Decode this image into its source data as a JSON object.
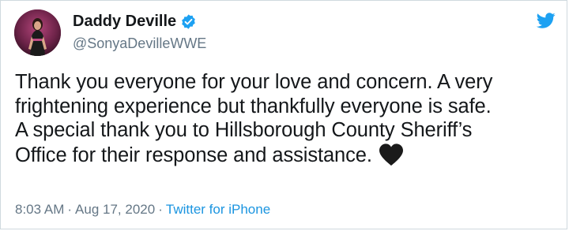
{
  "user": {
    "display_name": "Daddy Deville",
    "handle": "@SonyaDevilleWWE",
    "verified": true
  },
  "tweet": {
    "line1": "Thank you everyone for your love and concern. A very",
    "line2": "frightening experience but thankfully everyone is safe.",
    "line3": "A special thank you to Hillsborough County Sheriff’s",
    "line4": "Office for their response and assistance.",
    "emoji": "black-heart-icon"
  },
  "meta": {
    "time": "8:03 AM",
    "separator": "·",
    "date": "Aug 17, 2020",
    "source": "Twitter for iPhone"
  },
  "colors": {
    "accent": "#1da1f2",
    "link": "#1b95e0",
    "muted": "#657786",
    "text": "#14171a",
    "border": "#cfd9de"
  },
  "icons": {
    "logo": "twitter-bird-icon",
    "verified": "verified-badge-icon"
  }
}
